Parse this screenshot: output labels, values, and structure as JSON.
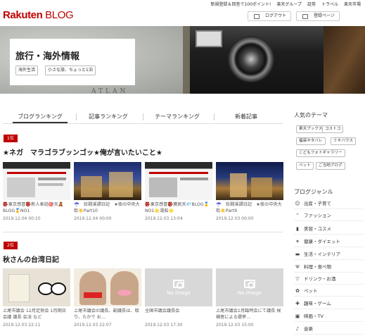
{
  "header": {
    "logo_brand": "Rakuten",
    "logo_product": "BLOG",
    "top_links": [
      "新規登録＆回答で100ポイント!",
      "楽天グループ",
      "証券",
      "トラベル",
      "楽天市場"
    ],
    "logout_label": "ログアウト",
    "register_label": "登録ページ"
  },
  "hero": {
    "title": "旅行・海外情報",
    "tags": [
      "海外生活",
      "小さな旅、ちょっと1泊"
    ],
    "watermark": "ATLAN"
  },
  "tabs": [
    "ブログランキング",
    "記事ランキング",
    "テーマランキング",
    "新着記事"
  ],
  "rankings": [
    {
      "rank": "1位",
      "title": "★ネガ　マラゴラブッンゴッ★俺が言いたいこと★",
      "cards": [
        {
          "caption": "👺東京感冒👺新人奉話🎯天🧸BLOG🥇NO1",
          "date": "2019.12.04 00:10"
        },
        {
          "caption": "☂️　珍鬪溪譚日記　★夜の中央大街☀️Part10",
          "date": "2019.12.04 00:00"
        },
        {
          "caption": "👺東京感冒👺寶劍天💎BLOG🥇NO1🌟湯船🌟",
          "date": "2019.12.03 13:04"
        },
        {
          "caption": "☂️　珍鬪溪譚日記　★夜の中央大街☀️Part9",
          "date": "2019.12.03 00:00"
        }
      ]
    },
    {
      "rank": "2位",
      "title": "秋さんの台湾日記",
      "cards": [
        {
          "caption": "上尾市議会 12月定例会 1月期日会議 議長 会派 など",
          "date": "2019.12.03 22:11"
        },
        {
          "caption": "上尾市議会の議長、副議長は、取り、たかで お…",
          "date": "2019.12.03 22:07"
        },
        {
          "caption": "全国市議会議長会",
          "date": "2019.12.03 17:30"
        },
        {
          "caption": "上尾市議会1月臨時会にて議長 候補者による選挙…",
          "date": "2019.12.03 15:00"
        }
      ]
    }
  ],
  "no_image_label": "No Image",
  "sidebar": {
    "themes_heading": "人気のテーマ",
    "themes": [
      "楽天ブックス",
      "コストコ",
      "福袋ネタバレ",
      "ミキハウス",
      "こどもフォトギャラリー",
      "ペット",
      "ご当地ブログ"
    ],
    "genres_heading": "ブログジャンル",
    "genres": [
      {
        "label": "出産・子育て",
        "icon": "baby-icon"
      },
      {
        "label": "ファッション",
        "icon": "hanger-icon"
      },
      {
        "label": "美容・コスメ",
        "icon": "lipstick-icon"
      },
      {
        "label": "健康・ダイエット",
        "icon": "running-icon"
      },
      {
        "label": "生活・インテリア",
        "icon": "sofa-icon"
      },
      {
        "label": "料理・食べ物",
        "icon": "fork-knife-icon"
      },
      {
        "label": "ドリンク・お酒",
        "icon": "glass-icon"
      },
      {
        "label": "ペット",
        "icon": "paw-icon"
      },
      {
        "label": "趣味・ゲーム",
        "icon": "game-icon"
      },
      {
        "label": "映画・TV",
        "icon": "film-icon"
      },
      {
        "label": "音楽",
        "icon": "music-icon"
      }
    ]
  }
}
